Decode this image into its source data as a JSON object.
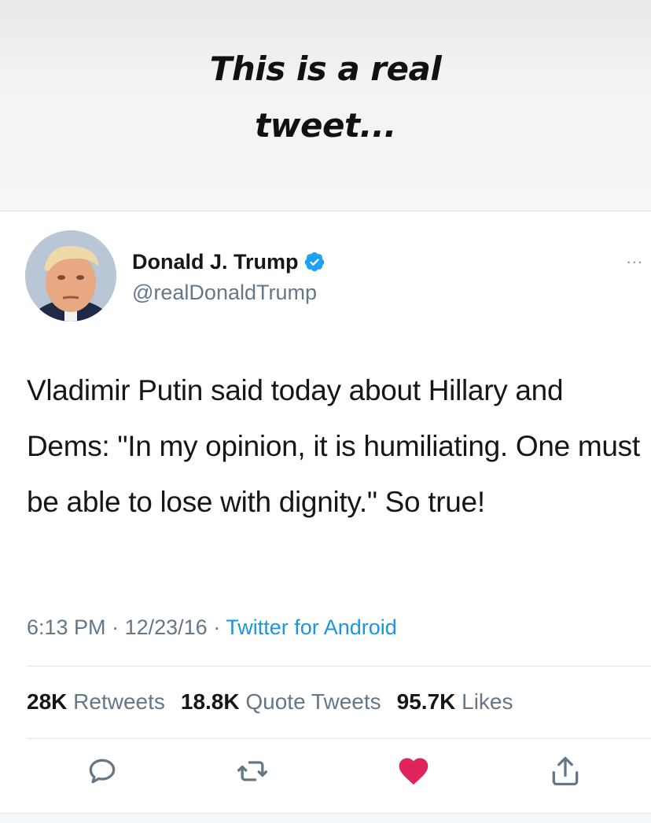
{
  "caption": {
    "line1": "This is a real",
    "line2": "tweet..."
  },
  "tweet": {
    "author_name": "Donald J. Trump",
    "handle": "@realDonaldTrump",
    "more_label": "...",
    "text": "Vladimir Putin said today about Hillary and Dems: \"In my opinion, it is humiliating. One must be able to lose with dignity.\"  So true!",
    "time": "6:13 PM",
    "date": "12/23/16",
    "source": "Twitter for Android",
    "retweets_count": "28K",
    "retweets_label": "Retweets",
    "quote_count": "18.8K",
    "quote_label": "Quote Tweets",
    "likes_count": "95.7K",
    "likes_label": "Likes"
  },
  "colors": {
    "accent": "#1da1f2",
    "like": "#e0245e",
    "muted": "#657786"
  },
  "icons": {
    "reply": "reply-icon",
    "retweet": "retweet-icon",
    "like": "heart-icon",
    "share": "share-icon",
    "verified": "verified-badge-icon"
  }
}
